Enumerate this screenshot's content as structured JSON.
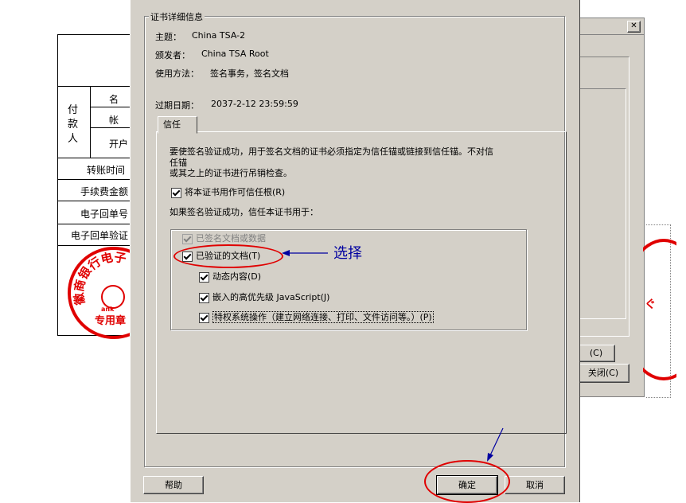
{
  "background_doc": {
    "row_labels": [
      "名",
      "帐",
      "开户"
    ],
    "payer_label": "付款人",
    "rows": [
      "转账时间",
      "手续费金额",
      "电子回单号",
      "电子回单验证"
    ],
    "seal_text": "徽商银行电子",
    "seal_bottom": "专用章",
    "seal_logo_text": "ank"
  },
  "bg_window": {
    "button_c": "(C)",
    "close_button": "关闭(C)",
    "close_icon": "✕",
    "stamp_char": "ぐ"
  },
  "dialog": {
    "group_title": "证书详细信息",
    "subject_label": "主题：",
    "subject_value": "China TSA-2",
    "issuer_label": "颁发者：",
    "issuer_value": "China TSA Root",
    "usage_label": "使用方法：",
    "usage_value": "签名事务，签名文档",
    "expiry_label": "过期日期：",
    "expiry_value": "2037-2-12 23:59:59",
    "tab_label": "信任",
    "description_line1": "要使签名验证成功，用于签名文档的证书必须指定为信任锚或链接到信任锚。不对信",
    "description_line2": "任锚",
    "description_line3": "或其之上的证书进行吊销检查。",
    "trusted_root_label": "将本证书用作可信任根(R)",
    "trust_for_label": "如果签名验证成功，信任本证书用于：",
    "options": {
      "signed_docs": "已签名文档或数据",
      "certified_docs": "已验证的文档(T)",
      "dynamic": "动态内容(D)",
      "javascript": "嵌入的高优先级 JavaScript(J)",
      "privileged": "特权系统操作（建立网络连接、打印、文件访问等。）(P)"
    },
    "help_button": "帮助",
    "ok_button": "确定",
    "cancel_button": "取消"
  },
  "annotation": {
    "select_text": "选择"
  }
}
